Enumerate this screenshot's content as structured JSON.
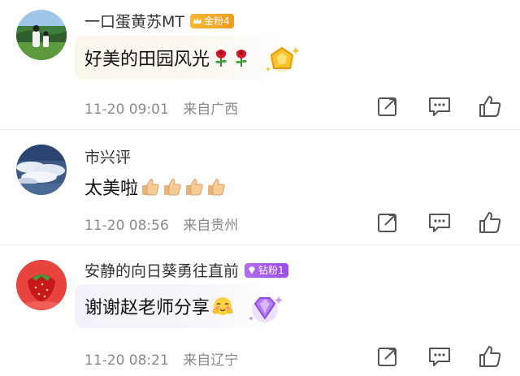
{
  "comments": [
    {
      "username": "一口蛋黄苏MT",
      "badge": "金粉4",
      "badge_color": "#f4a623",
      "content": "好美的田园风光",
      "emojis": [
        "rose",
        "rose"
      ],
      "bubble_decoration": "gold-gem-sticker",
      "time": "11-20 09:01",
      "location": "来自广西",
      "actions": [
        "share-icon",
        "comment-icon",
        "like-icon"
      ]
    },
    {
      "username": "市兴评",
      "content": "太美啦",
      "emojis": [
        "thumbs-up",
        "thumbs-up",
        "thumbs-up",
        "thumbs-up"
      ],
      "time": "11-20 08:56",
      "location": "来自贵州",
      "actions": [
        "share-icon",
        "comment-icon",
        "like-icon"
      ]
    },
    {
      "username": "安静的向日葵勇往直前",
      "badge": "钻粉1",
      "badge_color": "#a35ded",
      "content": "谢谢赵老师分享",
      "emojis": [
        "blushing-face"
      ],
      "bubble_decoration": "purple-diamond-sticker",
      "time": "11-20 08:21",
      "location": "来自辽宁",
      "actions": [
        "share-icon",
        "comment-icon",
        "like-icon"
      ]
    }
  ],
  "colors": {
    "meta_text": "#8a8a8a",
    "username_text": "#333333",
    "content_text": "#111111",
    "icon_stroke": "#555555"
  }
}
